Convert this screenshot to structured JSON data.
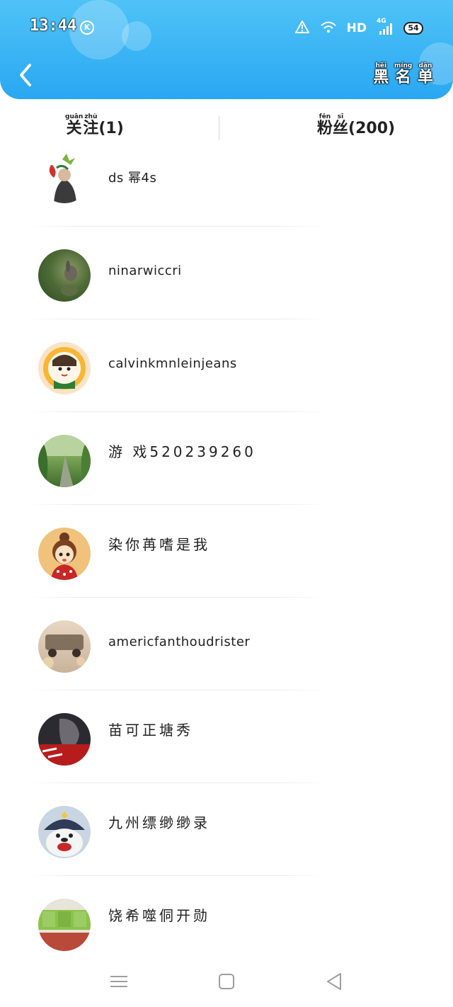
{
  "status_bar": {
    "time": "13:44",
    "k_badge": "K",
    "network": "HD",
    "cell": "4G",
    "battery": "54"
  },
  "header": {
    "blacklist": {
      "label": "黑名单",
      "pinyin": [
        "hēi",
        "míng",
        "dān"
      ]
    }
  },
  "tabs": {
    "follow": {
      "label": "关注(1)",
      "pinyin": [
        "guān",
        "zhù"
      ]
    },
    "fans": {
      "label": "粉丝(200)",
      "pinyin": [
        "fěn",
        "sī"
      ]
    }
  },
  "users": [
    {
      "name": "ds 幂4s",
      "avatar": "flower-portrait"
    },
    {
      "name": "ninarwiccri",
      "avatar": "rabbit-photo"
    },
    {
      "name": "calvinkmnleinjeans",
      "avatar": "cartoon-girl-yellow"
    },
    {
      "name": "游 戏520239260",
      "avatar": "green-road"
    },
    {
      "name": "染你苒嗜是我",
      "avatar": "cartoon-girl-bun"
    },
    {
      "name": "americfanthoudrister",
      "avatar": "blurry-car"
    },
    {
      "name": "苗可正塘秀",
      "avatar": "dark-artwork"
    },
    {
      "name": "九州缥缈缈录",
      "avatar": "cartoon-bear-hat"
    },
    {
      "name": "饶希噬侗开勋",
      "avatar": "green-cake"
    }
  ],
  "colors": {
    "header_top": "#4fc3f7",
    "header_bottom": "#29a7f2",
    "text": "#222222",
    "divider": "#ececec",
    "nav_icon": "#9e9e9e"
  }
}
